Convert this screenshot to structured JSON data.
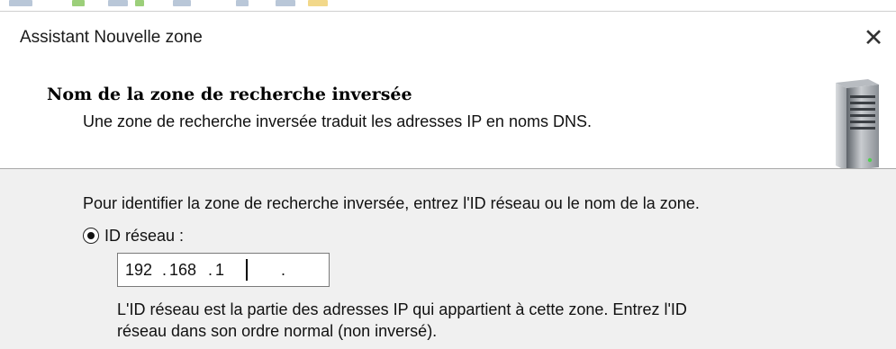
{
  "window": {
    "title": "Assistant Nouvelle zone",
    "close_glyph": "✕"
  },
  "header": {
    "title": "Nom de la zone de recherche inversée",
    "subtitle": "Une zone de recherche inversée traduit les adresses IP en noms DNS.",
    "icon": "server-icon"
  },
  "body": {
    "instruction": "Pour identifier la zone de recherche inversée, entrez l'ID réseau ou le nom de la zone.",
    "radio_network_id": {
      "label": "ID réseau :",
      "selected": true
    },
    "ip_field": {
      "octet1": "192",
      "sep1": ".",
      "octet2": "168",
      "sep2": ".",
      "octet3": "1",
      "sep3": ".",
      "octet4": ""
    },
    "description_line1": "L'ID réseau est la partie des adresses IP qui appartient à cette zone. Entrez l'ID",
    "description_line2": "réseau dans son ordre normal (non inversé)."
  }
}
